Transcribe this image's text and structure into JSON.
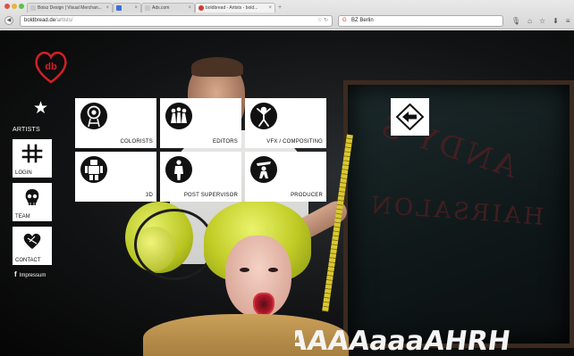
{
  "browser": {
    "tabs": [
      {
        "label": "Boisz Design | Visual Merchan...",
        "favicon_color": "#c9c9c9"
      },
      {
        "label": "",
        "favicon_color": "#3b6fd6"
      },
      {
        "label": "Ads.com",
        "favicon_color": "#c9c9c9"
      },
      {
        "label": "boldbread - Artists - bold...",
        "favicon_color": "#d23a2b"
      }
    ],
    "tab_close": "×",
    "new_tab": "+",
    "url": {
      "host": "boldbread.de",
      "path": "/artists/"
    },
    "url_reload": "↻",
    "url_star": "☆",
    "search": {
      "engine_icon": "G",
      "value": "BZ Berlin"
    },
    "toolbar_icons": {
      "microphone": "🎙",
      "home": "⌂",
      "bookmark": "☆",
      "download": "⬇",
      "menu": "≡"
    },
    "nav": {
      "back": "◀",
      "forward": "▶"
    }
  },
  "site": {
    "logo_text": "db",
    "accent_color": "#d61f26",
    "section_label": "ARTISTS",
    "sidebar": [
      {
        "label": "LOGIN",
        "icon": "hashtag-icon"
      },
      {
        "label": "TEAM",
        "icon": "skull-icon"
      },
      {
        "label": "CONTACT",
        "icon": "heart-icon"
      }
    ],
    "footer": {
      "facebook": "f",
      "impressum": "Impressum"
    },
    "categories": [
      {
        "label": "COLORISTS",
        "icon": "colorist-icon"
      },
      {
        "label": "EDITORS",
        "icon": "editors-icon"
      },
      {
        "label": "VFX / COMPOSITING",
        "icon": "vfx-icon"
      },
      {
        "label": "3D",
        "icon": "robot-icon"
      },
      {
        "label": "POST SUPERVISOR",
        "icon": "supervisor-icon"
      },
      {
        "label": "PRODUCER",
        "icon": "producer-icon"
      }
    ],
    "back_icon": "back-arrow-icon"
  },
  "background": {
    "mirror_text_line1": "ANDY'S",
    "mirror_text_line2": "HAIRSALON",
    "scream_text": "AAAAaaaAHRH"
  }
}
